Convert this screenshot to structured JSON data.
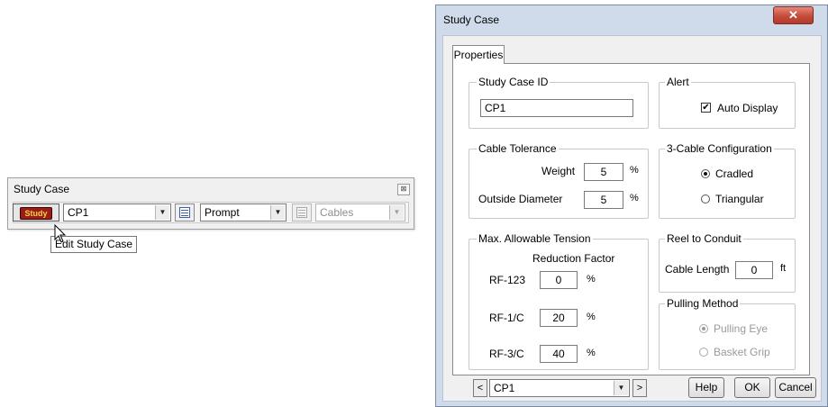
{
  "toolbar": {
    "title": "Study Case",
    "close_glyph": "⊠",
    "study_button_label": "Study",
    "study_case_value": "CP1",
    "mode_value": "Prompt",
    "report_value": "Cables",
    "dropdown_arrow": "▼",
    "tooltip": "Edit Study Case"
  },
  "dialog": {
    "title": "Study Case",
    "close_glyph": "✕",
    "tab": "Properties",
    "study_case_id": {
      "label": "Study Case ID",
      "value": "CP1"
    },
    "alert": {
      "label": "Alert",
      "auto_display_label": "Auto Display",
      "auto_display_checked": true,
      "check_glyph": "✔"
    },
    "cable_tolerance": {
      "label": "Cable Tolerance",
      "weight_label": "Weight",
      "weight_value": "5",
      "weight_unit": "%",
      "od_label": "Outside Diameter",
      "od_value": "5",
      "od_unit": "%"
    },
    "three_cable_config": {
      "label": "3-Cable Configuration",
      "options": [
        "Cradled",
        "Triangular"
      ],
      "selected": "Cradled"
    },
    "max_tension": {
      "label": "Max. Allowable Tension",
      "subheader": "Reduction Factor",
      "rows": [
        {
          "label": "RF-123",
          "value": "0",
          "unit": "%"
        },
        {
          "label": "RF-1/C",
          "value": "20",
          "unit": "%"
        },
        {
          "label": "RF-3/C",
          "value": "40",
          "unit": "%"
        }
      ]
    },
    "reel_to_conduit": {
      "label": "Reel to Conduit",
      "cable_length_label": "Cable Length",
      "cable_length_value": "0",
      "unit": "ft"
    },
    "pulling_method": {
      "label": "Pulling Method",
      "options": [
        "Pulling Eye",
        "Basket Grip"
      ],
      "selected": "Pulling Eye",
      "disabled": true
    },
    "footer": {
      "prev": "<",
      "next": ">",
      "case_value": "CP1",
      "dropdown_arrow": "▼",
      "help": "Help",
      "ok": "OK",
      "cancel": "Cancel"
    }
  },
  "colors": {
    "study_icon_bg": "#9b1b16",
    "study_icon_text": "#f6d24a",
    "close_button_red": "#c44b3a",
    "dialog_frame": "#cfdbea"
  }
}
